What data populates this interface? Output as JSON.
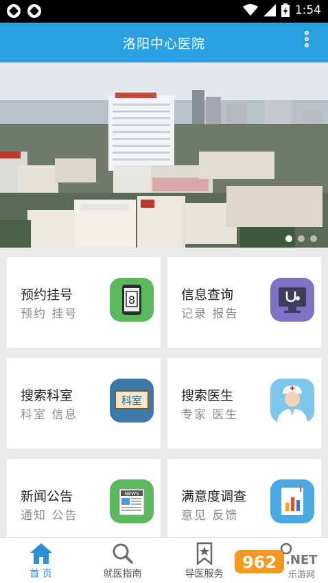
{
  "status_bar": {
    "time": "1:54"
  },
  "app_bar": {
    "title": "洛阳中心医院"
  },
  "banner": {
    "slide_count": 3,
    "active_slide": 1
  },
  "cards": [
    {
      "title": "预约挂号",
      "subtitle": "预约  挂号",
      "icon": "phone-calendar-icon",
      "icon_text": "8",
      "color": "#5cb85c"
    },
    {
      "title": "信息查询",
      "subtitle": "记录  报告",
      "icon": "stethoscope-monitor-icon",
      "color": "#7e72c4"
    },
    {
      "title": "搜索科室",
      "subtitle": "科室  信息",
      "icon": "department-sign-icon",
      "icon_text": "科室",
      "color": "#3d79a8"
    },
    {
      "title": "搜索医生",
      "subtitle": "专家  医生",
      "icon": "doctor-avatar-icon",
      "color": "#7ec7ea"
    },
    {
      "title": "新闻公告",
      "subtitle": "通知  公告",
      "icon": "newspaper-icon",
      "icon_text": "NEWS",
      "color": "#5cb85c"
    },
    {
      "title": "满意度调查",
      "subtitle": "意见  反馈",
      "icon": "survey-chart-icon",
      "color": "#4aa8e0"
    }
  ],
  "tab_bar": {
    "tabs": [
      {
        "label": "首 页",
        "icon": "home-icon",
        "active": true
      },
      {
        "label": "就医指南",
        "icon": "search-icon",
        "active": false
      },
      {
        "label": "导医服务",
        "icon": "star-bookmark-icon",
        "active": false
      },
      {
        "label": "",
        "icon": "person-icon",
        "active": false
      }
    ]
  },
  "watermark": {
    "text_main": "962.NET",
    "text_sub": "乐游网"
  },
  "colors": {
    "primary": "#2aa0e0",
    "tab_active": "#2a90d8"
  }
}
